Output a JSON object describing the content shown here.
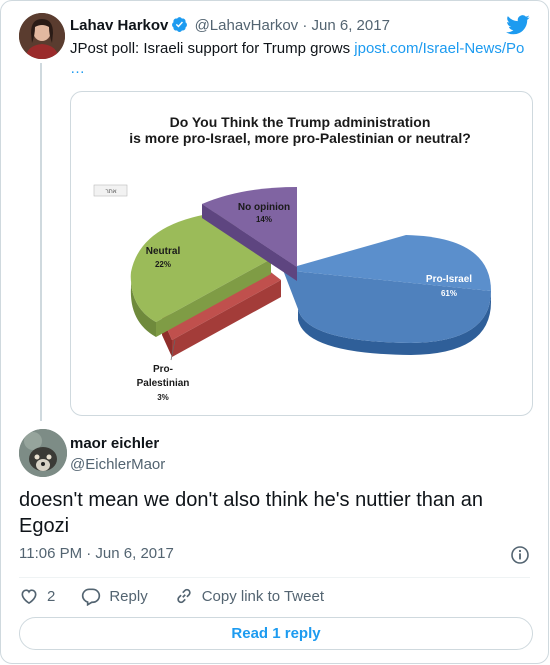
{
  "tweet": {
    "author_name": "Lahav Harkov",
    "author_handle": "@LahavHarkov",
    "date": "· Jun 6, 2017",
    "text": "JPost poll: Israeli support for Trump grows ",
    "link_text": "jpost.com/Israel-News/Po …"
  },
  "chart_data": {
    "type": "pie",
    "title_line1": "Do You Think the Trump administration",
    "title_line2": "is more pro-Israel, more pro-Palestinian or neutral?",
    "corner_tag": "אתר",
    "slices": [
      {
        "label": "Pro-Israel",
        "value": 61,
        "value_text": "61%",
        "color": "#4a7ebb"
      },
      {
        "label_line1": "Pro-",
        "label_line2": "Palestinian",
        "value": 3,
        "value_text": "3%",
        "color": "#c0504d"
      },
      {
        "label": "Neutral",
        "value": 22,
        "value_text": "22%",
        "color": "#9bbb59"
      },
      {
        "label": "No opinion",
        "value": 14,
        "value_text": "14%",
        "color": "#7a5fa0"
      }
    ]
  },
  "reply": {
    "author_name": "maor eichler",
    "author_handle": "@EichlerMaor",
    "text": "doesn't mean we don't also think he's nuttier than an Egozi",
    "timestamp": "11:06 PM · Jun 6, 2017"
  },
  "actions": {
    "like_count": "2",
    "reply_label": "Reply",
    "copy_label": "Copy link to Tweet",
    "read_replies_label": "Read 1 reply"
  },
  "colors": {
    "accent": "#1d9bf0",
    "muted": "#536471",
    "border": "#cfd9de"
  }
}
